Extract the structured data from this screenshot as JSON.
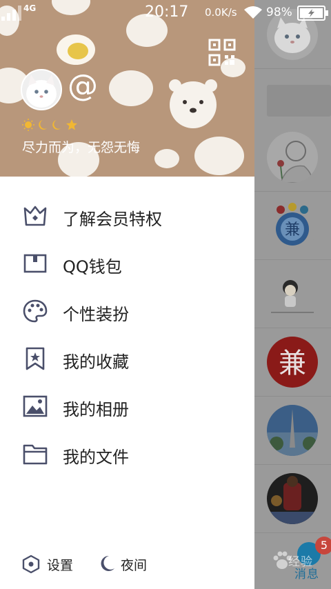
{
  "status_bar": {
    "network_type": "4G",
    "time": "20:17",
    "net_speed": "0.0K/s",
    "battery": "98%"
  },
  "profile": {
    "nickname": "@",
    "signature": "尽力而为，无怨无悔",
    "level_icons": [
      "sun-icon",
      "moon-icon",
      "moon-icon",
      "star-icon"
    ],
    "qr_icon": "qr-code-icon"
  },
  "menu": {
    "items": [
      {
        "label": "了解会员特权",
        "icon": "crown-icon"
      },
      {
        "label": "QQ钱包",
        "icon": "wallet-icon"
      },
      {
        "label": "个性装扮",
        "icon": "palette-icon"
      },
      {
        "label": "我的收藏",
        "icon": "bookmark-star-icon"
      },
      {
        "label": "我的相册",
        "icon": "photo-icon"
      },
      {
        "label": "我的文件",
        "icon": "folder-icon"
      }
    ]
  },
  "footer": {
    "settings_label": "设置",
    "night_label": "夜间"
  },
  "chat_list": {
    "unread_count": "5",
    "messages_tab_label": "消息"
  },
  "watermark": "经验",
  "colors": {
    "header_bg": "#b8977b",
    "icon_color": "#4a4f6a",
    "badge": "#c7463c",
    "accent_blue": "#1b7aa8"
  }
}
